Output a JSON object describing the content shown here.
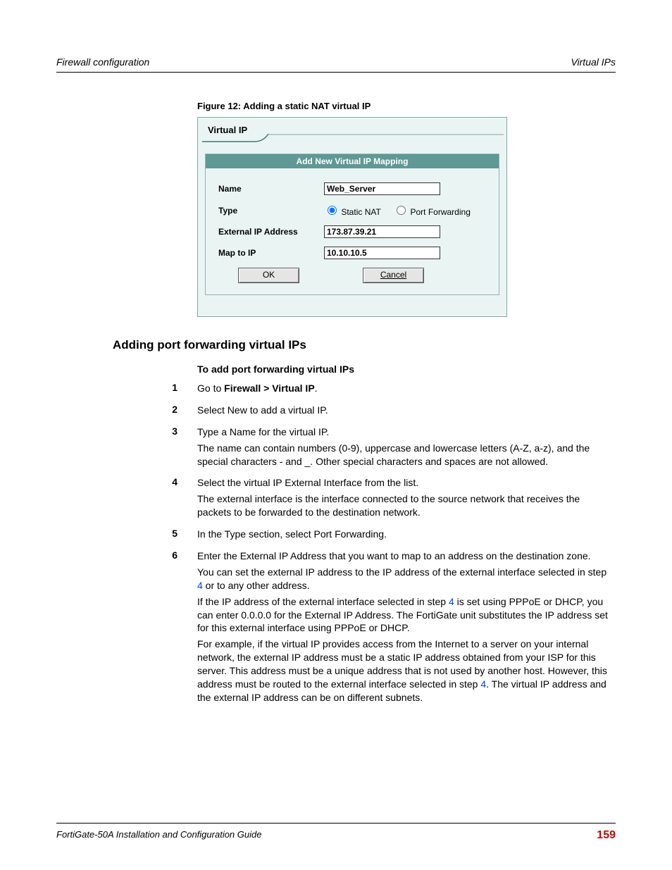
{
  "header": {
    "left": "Firewall configuration",
    "right": "Virtual IPs"
  },
  "figure": {
    "caption": "Figure 12: Adding a static NAT virtual IP",
    "tab_label": "Virtual IP",
    "form_header": "Add New Virtual IP Mapping",
    "labels": {
      "name": "Name",
      "type": "Type",
      "ext_ip": "External IP Address",
      "map_to": "Map to IP"
    },
    "values": {
      "name": "Web_Server",
      "ext_ip": "173.87.39.21",
      "map_to": "10.10.10.5"
    },
    "radio": {
      "static_nat": "Static NAT",
      "port_fwd": "Port Forwarding"
    },
    "buttons": {
      "ok": "OK",
      "cancel": "Cancel"
    }
  },
  "section_heading": "Adding port forwarding virtual IPs",
  "subheading": "To add port forwarding virtual IPs",
  "steps": {
    "n1": "1",
    "n2": "2",
    "n3": "3",
    "n4": "4",
    "n5": "5",
    "n6": "6",
    "s1_a": "Go to ",
    "s1_b": "Firewall > Virtual IP",
    "s1_c": ".",
    "s2": "Select New to add a virtual IP.",
    "s3a": "Type a Name for the virtual IP.",
    "s3b": "The name can contain numbers (0-9), uppercase and lowercase letters (A-Z, a-z), and the special characters - and _. Other special characters and spaces are not allowed.",
    "s4a": "Select the virtual IP External Interface from the list.",
    "s4b": "The external interface is the interface connected to the source network that receives the packets to be forwarded to the destination network.",
    "s5": "In the Type section, select Port Forwarding.",
    "s6a": "Enter the External IP Address that you want to map to an address on the destination zone.",
    "s6b_pre": "You can set the external IP address to the IP address of the external interface selected in step ",
    "s6b_link": "4",
    "s6b_post": " or to any other address.",
    "s6c_pre": "If the IP address of the external interface selected in step ",
    "s6c_link": "4",
    "s6c_post": " is set using PPPoE or DHCP, you can enter 0.0.0.0 for the External IP Address. The FortiGate unit substitutes the IP address set for this external interface using PPPoE or DHCP.",
    "s6d_pre": "For example, if the virtual IP provides access from the Internet to a server on your internal network, the external IP address must be a static IP address obtained from your ISP for this server. This address must be a unique address that is not used by another host. However, this address must be routed to the external interface selected in step ",
    "s6d_link": "4",
    "s6d_post": ". The virtual IP address and the external IP address can be on different subnets."
  },
  "footer": {
    "left": "FortiGate-50A Installation and Configuration Guide",
    "right": "159"
  }
}
